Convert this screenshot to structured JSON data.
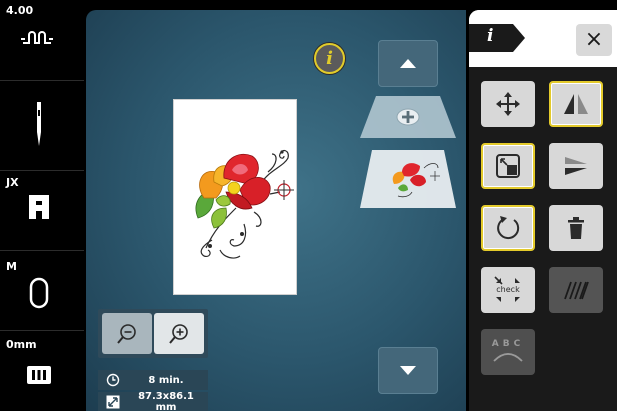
{
  "sidebar": {
    "tension_value": "4.00",
    "foot_label": "JX",
    "bobbin_label": "M",
    "height_value": "0mm"
  },
  "canvas": {
    "info_button_glyph": "i"
  },
  "status": {
    "time": "8 min.",
    "size": "87.3x86.1 mm"
  },
  "right_panel": {
    "tab_glyph": "i",
    "close_glyph": "×",
    "check_label": "check",
    "bending_letters": "ABC"
  },
  "colors": {
    "accent": "#e3ca2b",
    "canvas": "#2b566c",
    "panel": "#1a1a1a"
  }
}
